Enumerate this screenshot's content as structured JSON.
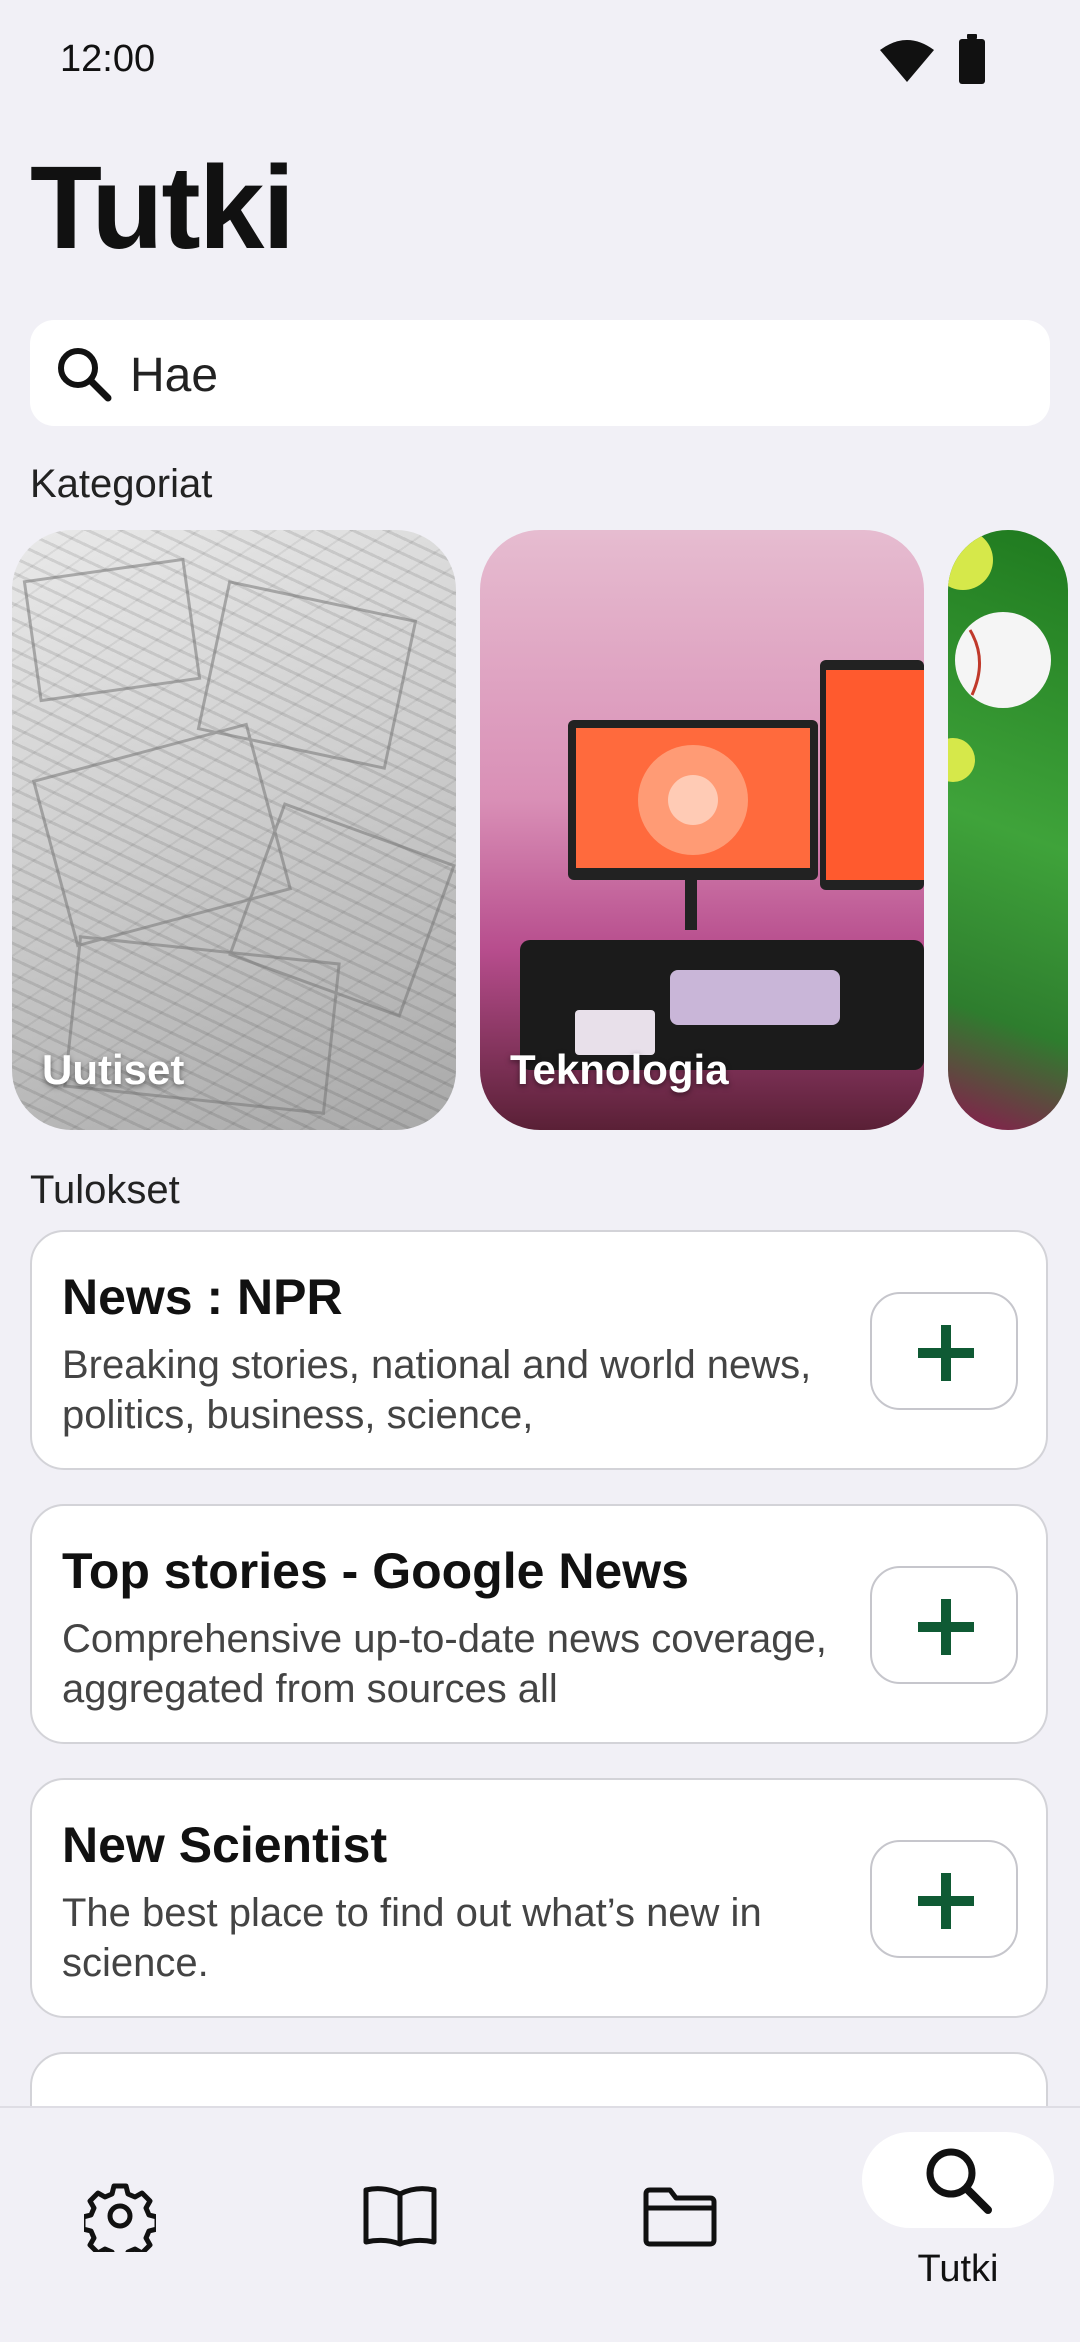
{
  "status_bar": {
    "time": "12:00"
  },
  "page_title": "Tutki",
  "search": {
    "placeholder": "Hae"
  },
  "categories_section": {
    "label": "Kategoriat",
    "items": [
      {
        "label": "Uutiset"
      },
      {
        "label": "Teknologia"
      },
      {
        "label": ""
      }
    ]
  },
  "results_section": {
    "label": "Tulokset",
    "items": [
      {
        "title": "News : NPR",
        "description": "Breaking stories, national and world news, politics, business, science,"
      },
      {
        "title": "Top stories - Google News",
        "description": "Comprehensive up-to-date news coverage, aggregated from sources all"
      },
      {
        "title": "New Scientist",
        "description": "The best place to find out what’s new in science."
      }
    ]
  },
  "bottom_nav": {
    "items": [
      {
        "icon": "gear-icon",
        "label": ""
      },
      {
        "icon": "book-icon",
        "label": ""
      },
      {
        "icon": "folder-icon",
        "label": ""
      },
      {
        "icon": "search-icon",
        "label": "Tutki",
        "active": true
      }
    ]
  },
  "colors": {
    "accent": "#0f5a34",
    "background": "#f1f0f6"
  }
}
